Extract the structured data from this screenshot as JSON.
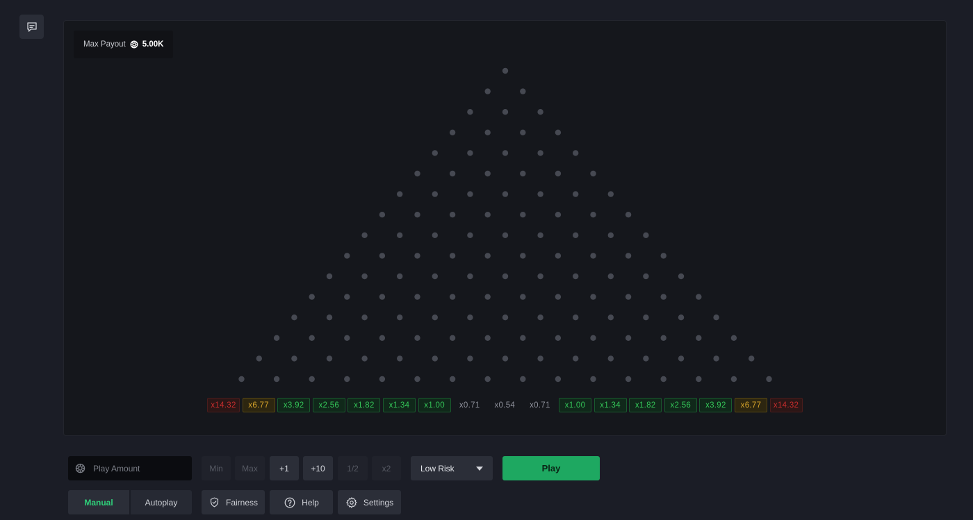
{
  "header": {
    "chat_icon": "chat-icon"
  },
  "board": {
    "max_payout_label": "Max Payout",
    "max_payout_value": "5.00K",
    "peg_color": "#464952",
    "multipliers": [
      {
        "label": "x14.32",
        "tone": "red"
      },
      {
        "label": "x6.77",
        "tone": "orange"
      },
      {
        "label": "x3.92",
        "tone": "green"
      },
      {
        "label": "x2.56",
        "tone": "green"
      },
      {
        "label": "x1.82",
        "tone": "green"
      },
      {
        "label": "x1.34",
        "tone": "green"
      },
      {
        "label": "x1.00",
        "tone": "green"
      },
      {
        "label": "x0.71",
        "tone": "plain"
      },
      {
        "label": "x0.54",
        "tone": "plain"
      },
      {
        "label": "x0.71",
        "tone": "plain"
      },
      {
        "label": "x1.00",
        "tone": "green"
      },
      {
        "label": "x1.34",
        "tone": "green"
      },
      {
        "label": "x1.82",
        "tone": "green"
      },
      {
        "label": "x2.56",
        "tone": "green"
      },
      {
        "label": "x3.92",
        "tone": "green"
      },
      {
        "label": "x6.77",
        "tone": "orange"
      },
      {
        "label": "x14.32",
        "tone": "red"
      }
    ]
  },
  "controls": {
    "amount_placeholder": "Play Amount",
    "buttons": {
      "min": "Min",
      "max": "Max",
      "plus1": "+1",
      "plus10": "+10",
      "half": "1/2",
      "double": "x2"
    },
    "risk_selected": "Low Risk",
    "play_label": "Play",
    "tabs": {
      "manual": "Manual",
      "autoplay": "Autoplay"
    },
    "fairness_label": "Fairness",
    "help_label": "Help",
    "settings_label": "Settings"
  },
  "colors": {
    "accent": "#1ea861",
    "accent_text": "#2fd07a",
    "background": "#1b1d26",
    "board": "#15171c"
  }
}
